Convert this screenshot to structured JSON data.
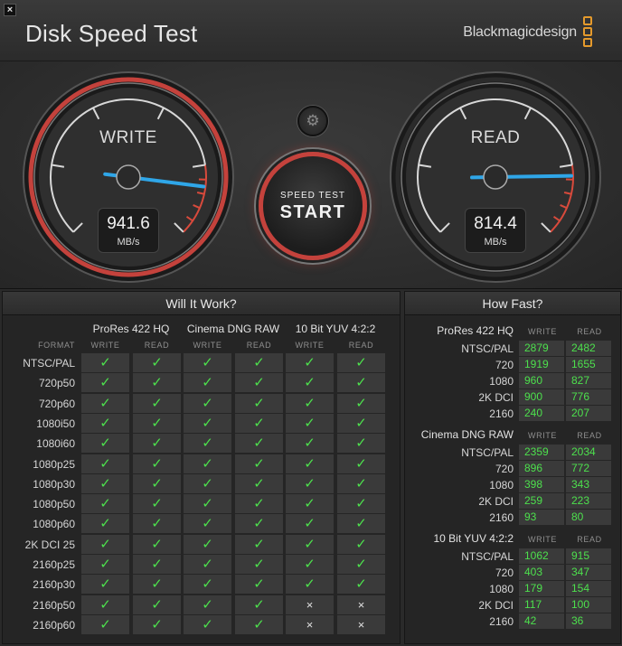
{
  "window": {
    "title": "Disk Speed Test",
    "brand": "Blackmagicdesign",
    "close_glyph": "×"
  },
  "colors": {
    "accent_red": "#c4423c",
    "needle_blue": "#2fa6e8",
    "check_green": "#4de04d",
    "logo_orange": "#e59a2c"
  },
  "gauges": {
    "write": {
      "label": "WRITE",
      "value": "941.6",
      "unit": "MB/s",
      "needle_fraction": 0.86
    },
    "read": {
      "label": "READ",
      "value": "814.4",
      "unit": "MB/s",
      "needle_fraction": 0.83
    }
  },
  "start_button": {
    "line1": "SPEED TEST",
    "line2": "START"
  },
  "settings_icon": "gear-icon",
  "will_it_work": {
    "title": "Will It Work?",
    "format_label": "FORMAT",
    "codecs": [
      "ProRes 422 HQ",
      "Cinema DNG RAW",
      "10 Bit YUV 4:2:2"
    ],
    "sub_write": "WRITE",
    "sub_read": "READ",
    "check_glyph": "✓",
    "cross_glyph": "×",
    "rows": [
      {
        "format": "NTSC/PAL",
        "ok": [
          1,
          1,
          1,
          1,
          1,
          1
        ]
      },
      {
        "format": "720p50",
        "ok": [
          1,
          1,
          1,
          1,
          1,
          1
        ]
      },
      {
        "format": "720p60",
        "ok": [
          1,
          1,
          1,
          1,
          1,
          1
        ]
      },
      {
        "format": "1080i50",
        "ok": [
          1,
          1,
          1,
          1,
          1,
          1
        ]
      },
      {
        "format": "1080i60",
        "ok": [
          1,
          1,
          1,
          1,
          1,
          1
        ]
      },
      {
        "format": "1080p25",
        "ok": [
          1,
          1,
          1,
          1,
          1,
          1
        ]
      },
      {
        "format": "1080p30",
        "ok": [
          1,
          1,
          1,
          1,
          1,
          1
        ]
      },
      {
        "format": "1080p50",
        "ok": [
          1,
          1,
          1,
          1,
          1,
          1
        ]
      },
      {
        "format": "1080p60",
        "ok": [
          1,
          1,
          1,
          1,
          1,
          1
        ]
      },
      {
        "format": "2K DCI 25",
        "ok": [
          1,
          1,
          1,
          1,
          1,
          1
        ]
      },
      {
        "format": "2160p25",
        "ok": [
          1,
          1,
          1,
          1,
          1,
          1
        ]
      },
      {
        "format": "2160p30",
        "ok": [
          1,
          1,
          1,
          1,
          1,
          1
        ]
      },
      {
        "format": "2160p50",
        "ok": [
          1,
          1,
          1,
          1,
          0,
          0
        ]
      },
      {
        "format": "2160p60",
        "ok": [
          1,
          1,
          1,
          1,
          0,
          0
        ]
      }
    ]
  },
  "how_fast": {
    "title": "How Fast?",
    "sub_write": "WRITE",
    "sub_read": "READ",
    "sections": [
      {
        "codec": "ProRes 422 HQ",
        "rows": [
          {
            "format": "NTSC/PAL",
            "write": "2879",
            "read": "2482"
          },
          {
            "format": "720",
            "write": "1919",
            "read": "1655"
          },
          {
            "format": "1080",
            "write": "960",
            "read": "827"
          },
          {
            "format": "2K DCI",
            "write": "900",
            "read": "776"
          },
          {
            "format": "2160",
            "write": "240",
            "read": "207"
          }
        ]
      },
      {
        "codec": "Cinema DNG RAW",
        "rows": [
          {
            "format": "NTSC/PAL",
            "write": "2359",
            "read": "2034"
          },
          {
            "format": "720",
            "write": "896",
            "read": "772"
          },
          {
            "format": "1080",
            "write": "398",
            "read": "343"
          },
          {
            "format": "2K DCI",
            "write": "259",
            "read": "223"
          },
          {
            "format": "2160",
            "write": "93",
            "read": "80"
          }
        ]
      },
      {
        "codec": "10 Bit YUV 4:2:2",
        "rows": [
          {
            "format": "NTSC/PAL",
            "write": "1062",
            "read": "915"
          },
          {
            "format": "720",
            "write": "403",
            "read": "347"
          },
          {
            "format": "1080",
            "write": "179",
            "read": "154"
          },
          {
            "format": "2K DCI",
            "write": "117",
            "read": "100"
          },
          {
            "format": "2160",
            "write": "42",
            "read": "36"
          }
        ]
      }
    ]
  }
}
